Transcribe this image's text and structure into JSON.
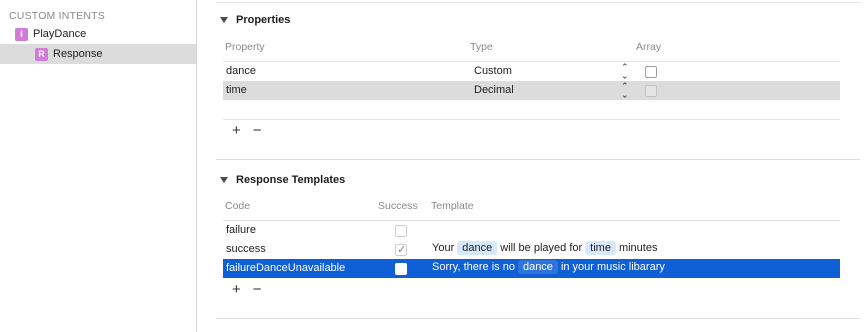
{
  "sidebar": {
    "header": "CUSTOM INTENTS",
    "items": [
      {
        "badge": "I",
        "label": "PlayDance"
      },
      {
        "badge": "R",
        "label": "Response"
      }
    ]
  },
  "properties": {
    "title": "Properties",
    "columns": {
      "property": "Property",
      "type": "Type",
      "array": "Array"
    },
    "rows": [
      {
        "property": "dance",
        "type": "Custom",
        "array": false
      },
      {
        "property": "time",
        "type": "Decimal",
        "array": false
      }
    ],
    "add_label": "+",
    "remove_label": "−"
  },
  "response_templates": {
    "title": "Response Templates",
    "columns": {
      "code": "Code",
      "success": "Success",
      "template": "Template"
    },
    "rows": [
      {
        "code": "failure",
        "success": false,
        "template": []
      },
      {
        "code": "success",
        "success": true,
        "template": {
          "t1": "Your",
          "tok1": "dance",
          "t2": "will be played for",
          "tok2": "time",
          "t3": "minutes"
        }
      },
      {
        "code": "failureDanceUnavailable",
        "success": false,
        "template": {
          "t1": "Sorry, there is no",
          "tok1": "dance",
          "t2": "in your music libarary"
        }
      }
    ],
    "add_label": "+",
    "remove_label": "−"
  },
  "colors": {
    "selection": "#0f5fd7",
    "badge": "#d27ad8",
    "token": "#d8e8fb"
  }
}
